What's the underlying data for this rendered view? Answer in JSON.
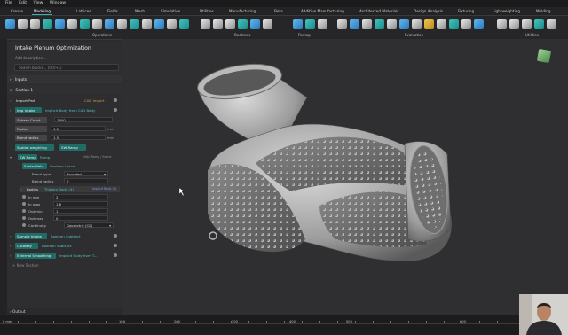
{
  "menubar": [
    "File",
    "Edit",
    "View",
    "Window"
  ],
  "tabs": [
    "Create",
    "Modeling",
    "Lattices",
    "Fields",
    "Mesh",
    "Simulation",
    "Utilities",
    "Manufacturing",
    "Beta",
    "Additive Manufacturing",
    "Architected Materials",
    "Design Analysis",
    "Fixturing",
    "Lightweighting",
    "Molding"
  ],
  "active_tab": "Modeling",
  "ribbon_groups": [
    "Operations",
    "Booleans",
    "Remap",
    "Evaluation",
    "Utilities"
  ],
  "notebook": {
    "title": "Intake Plenum Optimization",
    "description": "Add description...",
    "search_placeholder": "Search blocks... (Ctrl+L)",
    "inputs_label": "Inputs",
    "section_label": "Section 1",
    "blocks": {
      "import_part": {
        "name": "Import Part",
        "sub": "CAD Import"
      },
      "imp_intake": {
        "name": "Imp Intake",
        "sub": "Implicit Body from CAD Body"
      },
      "sphere_count": {
        "label": "Sphere Count",
        "value": "1600"
      },
      "radius": {
        "label": "Radius",
        "value": "1.5",
        "unit": "mm"
      },
      "blend_radius": {
        "label": "Blend radius",
        "value": "1.5",
        "unit": "mm"
      },
      "spatial_weighting": {
        "label": "Spatial weighting",
        "ref": "SW Ramp"
      },
      "sw_ramp": {
        "name": "SW Ramp",
        "sub": "Ramp",
        "sub2": "Help: Ramp / Scene"
      },
      "scalar_field": {
        "label": "Scalar field",
        "value": "Boolean Union"
      },
      "blend_type": {
        "label": "Blend type",
        "value": "Rounded"
      },
      "blend_radius2": {
        "label": "Blend radius",
        "value": "0"
      },
      "bodies": {
        "label": "Bodies",
        "value": "Thicken Body (4)",
        "value2": "Implicit Body (4)"
      },
      "in_min": {
        "label": "In min",
        "value": "2"
      },
      "in_max": {
        "label": "In max",
        "value": "1.6"
      },
      "out_min": {
        "label": "Out min",
        "value": "1"
      },
      "out_max": {
        "label": "Out max",
        "value": "0"
      },
      "continuity": {
        "label": "Continuity",
        "value": "Geometric (C0)"
      },
      "sample_intake": {
        "name": "Sample Intake",
        "sub": "Boolean Subtract"
      },
      "cutaway": {
        "name": "Cutaway",
        "sub": "Boolean Subtract"
      },
      "external_smoothing": {
        "name": "External Smoothing",
        "sub": "Implicit Body from T..."
      }
    },
    "new_section": "+ New Section",
    "output_label": "Output"
  },
  "ruler": {
    "units": "mm",
    "ticks": [
      "0 mm",
      "100",
      "200",
      "300",
      "400",
      "500",
      "600"
    ]
  },
  "colors": {
    "accent": "#34b3b0",
    "brand": "#2f7fc1",
    "warning": "#c99a3e",
    "panel": "#2e2e30",
    "viewport": "#2f2f31"
  }
}
